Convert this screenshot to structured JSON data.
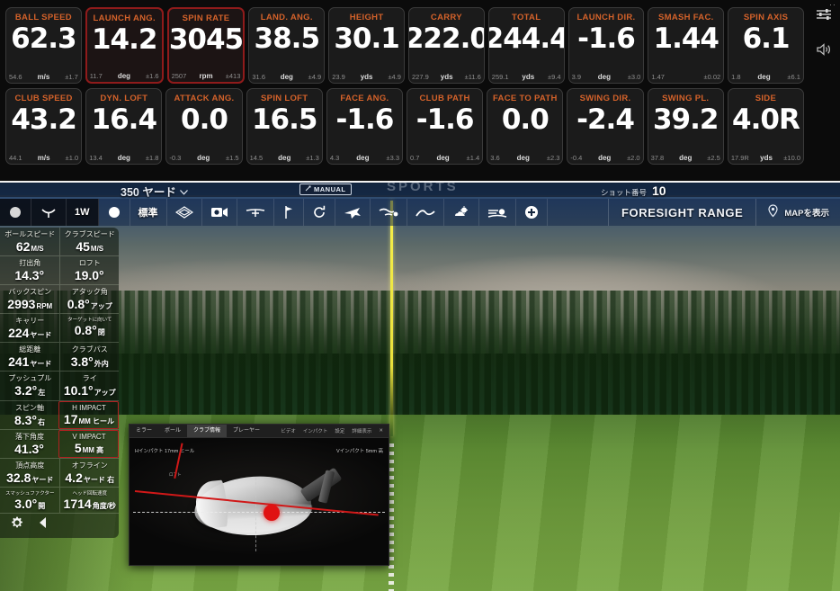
{
  "launch_monitor": {
    "rows": [
      [
        {
          "title": "BALL SPEED",
          "value": "62.3",
          "prev": "54.6",
          "unit": "m/s",
          "tol": "±1.7",
          "highlight": false
        },
        {
          "title": "LAUNCH ANG.",
          "value": "14.2",
          "prev": "11.7",
          "unit": "deg",
          "tol": "±1.6",
          "highlight": true
        },
        {
          "title": "SPIN RATE",
          "value": "3045",
          "prev": "2507",
          "unit": "rpm",
          "tol": "±413",
          "highlight": true
        },
        {
          "title": "LAND. ANG.",
          "value": "38.5",
          "prev": "31.6",
          "unit": "deg",
          "tol": "±4.9",
          "highlight": false
        },
        {
          "title": "HEIGHT",
          "value": "30.1",
          "prev": "23.9",
          "unit": "yds",
          "tol": "±4.9",
          "highlight": false
        },
        {
          "title": "CARRY",
          "value": "222.0",
          "prev": "227.9",
          "unit": "yds",
          "tol": "±11.6",
          "highlight": false
        },
        {
          "title": "TOTAL",
          "value": "244.4",
          "prev": "259.1",
          "unit": "yds",
          "tol": "±9.4",
          "highlight": false
        },
        {
          "title": "LAUNCH DIR.",
          "value": "-1.6",
          "prev": "3.9",
          "unit": "deg",
          "tol": "±3.0",
          "highlight": false
        },
        {
          "title": "SMASH FAC.",
          "value": "1.44",
          "prev": "1.47",
          "unit": "",
          "tol": "±0.02",
          "highlight": false
        },
        {
          "title": "SPIN AXIS",
          "value": "6.1",
          "prev": "1.8",
          "unit": "deg",
          "tol": "±6.1",
          "highlight": false
        }
      ],
      [
        {
          "title": "CLUB SPEED",
          "value": "43.2",
          "prev": "44.1",
          "unit": "m/s",
          "tol": "±1.0",
          "highlight": false
        },
        {
          "title": "DYN. LOFT",
          "value": "16.4",
          "prev": "13.4",
          "unit": "deg",
          "tol": "±1.8",
          "highlight": false
        },
        {
          "title": "ATTACK ANG.",
          "value": "0.0",
          "prev": "-0.3",
          "unit": "deg",
          "tol": "±1.5",
          "highlight": false
        },
        {
          "title": "SPIN LOFT",
          "value": "16.5",
          "prev": "14.5",
          "unit": "deg",
          "tol": "±1.3",
          "highlight": false
        },
        {
          "title": "FACE ANG.",
          "value": "-1.6",
          "prev": "4.3",
          "unit": "deg",
          "tol": "±3.3",
          "highlight": false
        },
        {
          "title": "CLUB PATH",
          "value": "-1.6",
          "prev": "0.7",
          "unit": "deg",
          "tol": "±1.4",
          "highlight": false
        },
        {
          "title": "FACE TO PATH",
          "value": "0.0",
          "prev": "3.6",
          "unit": "deg",
          "tol": "±2.3",
          "highlight": false
        },
        {
          "title": "SWING DIR.",
          "value": "-2.4",
          "prev": "-0.4",
          "unit": "deg",
          "tol": "±2.0",
          "highlight": false
        },
        {
          "title": "SWING PL.",
          "value": "39.2",
          "prev": "37.8",
          "unit": "deg",
          "tol": "±2.5",
          "highlight": false
        },
        {
          "title": "SIDE",
          "value": "4.0R",
          "prev": "17.9R",
          "unit": "yds",
          "tol": "±10.0",
          "highlight": false
        }
      ]
    ],
    "side_icons": [
      {
        "name": "sliders-icon"
      },
      {
        "name": "speaker-icon"
      }
    ],
    "window_dots": "··",
    "colors": {
      "title": "#d4622a",
      "value": "#ffffff",
      "highlight_border": "#8f1b1b",
      "panel_bg": "#0b0b0b"
    }
  },
  "simulator": {
    "top_bar": {
      "distance": "350 ヤード",
      "distance_caret": "⌄",
      "manual_badge": "MANUAL",
      "shot_number_label": "ショット番号",
      "shot_number_value": "10"
    },
    "toolbar": {
      "items": [
        {
          "name": "ball-icon",
          "label": ""
        },
        {
          "name": "tee-icon",
          "label": ""
        },
        {
          "name": "club-select",
          "label": "1W"
        },
        {
          "name": "ball-mode-icon",
          "label": ""
        },
        {
          "name": "standard-mode",
          "label": "標準"
        },
        {
          "name": "green-grid-icon",
          "label": ""
        },
        {
          "name": "camera-icon",
          "label": ""
        },
        {
          "name": "trajectory-icon",
          "label": ""
        },
        {
          "name": "flag-icon",
          "label": ""
        },
        {
          "name": "replay-icon",
          "label": ""
        },
        {
          "name": "flight-icon",
          "label": ""
        },
        {
          "name": "wind-icon",
          "label": ""
        },
        {
          "name": "terrain-icon",
          "label": ""
        },
        {
          "name": "weather-icon",
          "label": ""
        },
        {
          "name": "layers-icon",
          "label": ""
        },
        {
          "name": "add-icon",
          "label": ""
        }
      ],
      "brand": "FORESIGHT RANGE",
      "map_label": "MAPを表示",
      "watermark": "SPORTS"
    },
    "metrics_sidebar": {
      "rows": [
        [
          {
            "label": "ボールスピード",
            "value": "62",
            "unit": "M/S",
            "highlight": false,
            "tiny": false
          },
          {
            "label": "クラブスピード",
            "value": "45",
            "unit": "M/S",
            "highlight": false,
            "tiny": false
          }
        ],
        [
          {
            "label": "打出角",
            "value": "14.3°",
            "unit": "",
            "highlight": false,
            "tiny": false
          },
          {
            "label": "ロフト",
            "value": "19.0°",
            "unit": "",
            "highlight": false,
            "tiny": false
          }
        ],
        [
          {
            "label": "バックスピン",
            "value": "2993",
            "unit": "RPM",
            "highlight": false,
            "tiny": false
          },
          {
            "label": "アタック角",
            "value": "0.8°",
            "unit": "アップ",
            "highlight": false,
            "tiny": false
          }
        ],
        [
          {
            "label": "キャリー",
            "value": "224",
            "unit": "ヤード",
            "highlight": false,
            "tiny": false
          },
          {
            "label": "ターゲットに向いて",
            "value": "0.8°",
            "unit": "閉",
            "highlight": false,
            "tiny": true
          }
        ],
        [
          {
            "label": "総距離",
            "value": "241",
            "unit": "ヤード",
            "highlight": false,
            "tiny": false
          },
          {
            "label": "クラブパス",
            "value": "3.8°",
            "unit": "外内",
            "highlight": false,
            "tiny": false
          }
        ],
        [
          {
            "label": "プッシュプル",
            "value": "3.2°",
            "unit": "左",
            "highlight": false,
            "tiny": false
          },
          {
            "label": "ライ",
            "value": "10.1°",
            "unit": "アップ",
            "highlight": false,
            "tiny": false
          }
        ],
        [
          {
            "label": "スピン軸",
            "value": "8.3°",
            "unit": "右",
            "highlight": false,
            "tiny": false
          },
          {
            "label": "H IMPACT",
            "value": "17",
            "unit": "MM ヒール",
            "highlight": true,
            "tiny": false
          }
        ],
        [
          {
            "label": "落下角度",
            "value": "41.3°",
            "unit": "",
            "highlight": false,
            "tiny": false
          },
          {
            "label": "V IMPACT",
            "value": "5",
            "unit": "MM 高",
            "highlight": true,
            "tiny": false
          }
        ],
        [
          {
            "label": "頂点高度",
            "value": "32.8",
            "unit": "ヤード",
            "highlight": false,
            "tiny": false
          },
          {
            "label": "オフライン",
            "value": "4.2",
            "unit": "ヤード 右",
            "highlight": false,
            "tiny": false
          }
        ],
        [
          {
            "label": "スマッシュファクター",
            "value": "3.0°",
            "unit": "開",
            "highlight": false,
            "tiny": true
          },
          {
            "label": "ヘッド回転速度",
            "value": "1714",
            "unit": "角度/秒",
            "highlight": true,
            "tiny": true
          }
        ]
      ],
      "footer_icons": [
        {
          "name": "gear-icon"
        },
        {
          "name": "collapse-left-icon"
        }
      ]
    },
    "impact_window": {
      "tabs": [
        {
          "label": "ミラー",
          "active": false
        },
        {
          "label": "ボール",
          "active": false
        },
        {
          "label": "クラブ情報",
          "active": true
        },
        {
          "label": "プレーヤー",
          "active": false
        }
      ],
      "right_items": [
        {
          "label": "ビデオ"
        },
        {
          "label": "インパクト"
        },
        {
          "label": "設定"
        },
        {
          "label": "詳細表示"
        },
        {
          "label": "✕"
        }
      ],
      "caption_left": "Hインパクト 17mm ヒール",
      "caption_right": "Vインパクト 5mm 高",
      "arc_label": "ロフト"
    }
  }
}
